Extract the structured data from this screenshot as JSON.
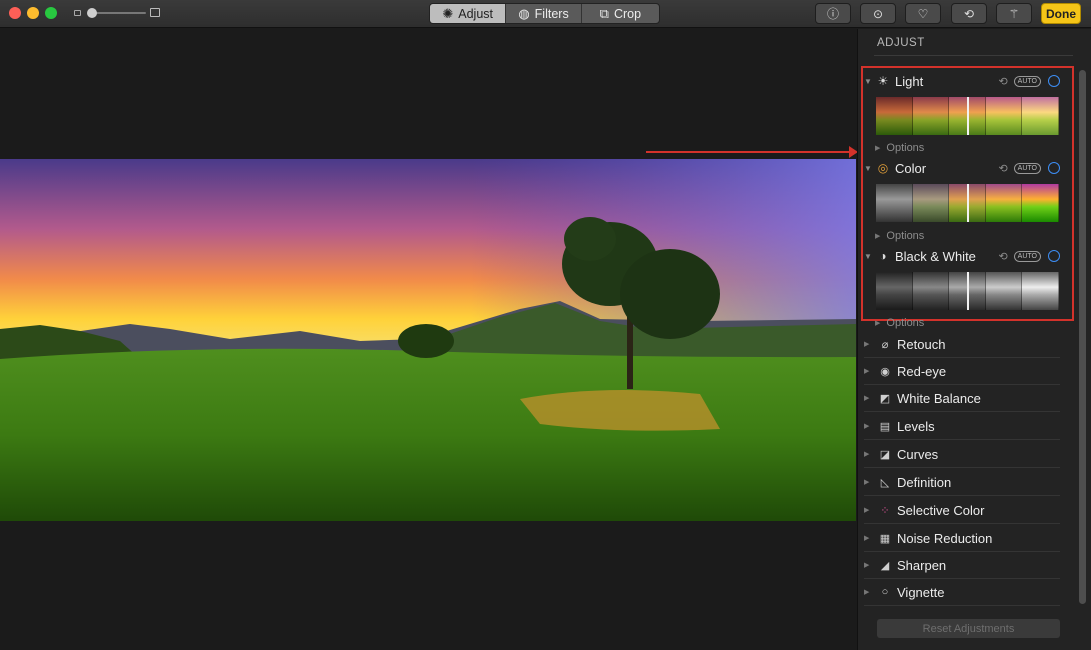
{
  "toolbar": {
    "tabs": [
      {
        "label": "Adjust",
        "icon": "adjust-dial-icon",
        "active": true
      },
      {
        "label": "Filters",
        "icon": "filters-circles-icon",
        "active": false
      },
      {
        "label": "Crop",
        "icon": "crop-icon",
        "active": false
      }
    ],
    "buttons": [
      "info-icon",
      "more-icon",
      "heart-icon",
      "rotate-icon",
      "magic-wand-icon"
    ],
    "done_label": "Done",
    "done_color": "#f5c518"
  },
  "sidebar": {
    "title": "ADJUST",
    "expanded_sections": [
      {
        "label": "Light",
        "icon": "sun-icon",
        "auto": "AUTO",
        "options": "Options"
      },
      {
        "label": "Color",
        "icon": "color-wheel-icon",
        "auto": "AUTO",
        "options": "Options"
      },
      {
        "label": "Black & White",
        "icon": "half-circle-icon",
        "auto": "AUTO",
        "options": "Options"
      }
    ],
    "tools": [
      {
        "label": "Retouch",
        "icon": "bandage-icon"
      },
      {
        "label": "Red-eye",
        "icon": "eye-icon"
      },
      {
        "label": "White Balance",
        "icon": "white-balance-icon"
      },
      {
        "label": "Levels",
        "icon": "levels-icon"
      },
      {
        "label": "Curves",
        "icon": "curves-icon"
      },
      {
        "label": "Definition",
        "icon": "definition-icon"
      },
      {
        "label": "Selective Color",
        "icon": "selective-color-icon"
      },
      {
        "label": "Noise Reduction",
        "icon": "noise-icon"
      },
      {
        "label": "Sharpen",
        "icon": "sharpen-icon"
      },
      {
        "label": "Vignette",
        "icon": "vignette-icon"
      }
    ],
    "reset_label": "Reset Adjustments"
  },
  "colors": {
    "annotation": "#d3322b",
    "toggle": "#3d8ef5"
  }
}
